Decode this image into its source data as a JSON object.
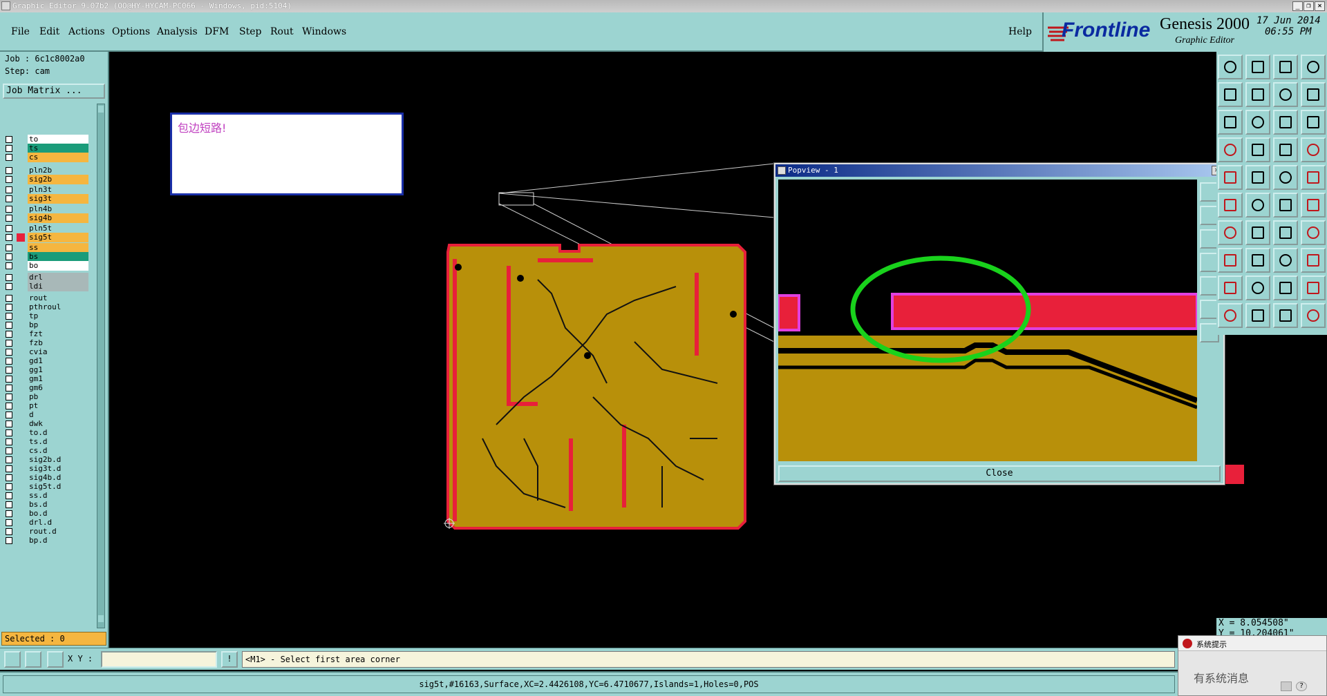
{
  "window": {
    "title": "Graphic Editor 9.07b2 (OO@HY-HYCAM-PC066 - Windows, pid:5104)",
    "controls": [
      "_",
      "❐",
      "✕"
    ]
  },
  "menu": [
    "File",
    "Edit",
    "Actions",
    "Options",
    "Analysis",
    "DFM",
    "Step",
    "Rout",
    "Windows"
  ],
  "help": "Help",
  "brand": {
    "logo": "Frontline",
    "product": "Genesis 2000",
    "subtitle": "Graphic Editor",
    "date": "17 Jun 2014",
    "time": "06:55 PM"
  },
  "job": {
    "job_line": "Job : 6c1c8002a0",
    "step_line": "Step: cam",
    "matrix_button": "Job Matrix ..."
  },
  "layers": [
    {
      "name": "to",
      "color": "#ffffff"
    },
    {
      "name": "ts",
      "color": "#1a9c7a"
    },
    {
      "name": "cs",
      "color": "#f5b640"
    },
    {
      "name": "pln2b",
      "color": "#9cd4d1"
    },
    {
      "name": "sig2b",
      "color": "#f5b640"
    },
    {
      "name": "pln3t",
      "color": "#9cd4d1"
    },
    {
      "name": "sig3t",
      "color": "#f5b640"
    },
    {
      "name": "pln4b",
      "color": "#9cd4d1"
    },
    {
      "name": "sig4b",
      "color": "#f5b640"
    },
    {
      "name": "pln5t",
      "color": "#9cd4d1"
    },
    {
      "name": "sig5t",
      "color": "#f5b640",
      "selected": true
    },
    {
      "name": "ss",
      "color": "#f5b640"
    },
    {
      "name": "bs",
      "color": "#1a9c7a"
    },
    {
      "name": "bo",
      "color": "#ffffff"
    },
    {
      "name": "drl",
      "color": "#a8b8b8"
    },
    {
      "name": "ldi",
      "color": "#a8b8b8"
    },
    {
      "name": "rout",
      "color": "#9cd4d1"
    },
    {
      "name": "pthroul",
      "color": "#9cd4d1"
    },
    {
      "name": "tp",
      "color": "#9cd4d1"
    },
    {
      "name": "bp",
      "color": "#9cd4d1"
    },
    {
      "name": "fzt",
      "color": "#9cd4d1"
    },
    {
      "name": "fzb",
      "color": "#9cd4d1"
    },
    {
      "name": "cvia",
      "color": "#9cd4d1"
    },
    {
      "name": "gd1",
      "color": "#9cd4d1"
    },
    {
      "name": "gg1",
      "color": "#9cd4d1"
    },
    {
      "name": "gm1",
      "color": "#9cd4d1"
    },
    {
      "name": "gm6",
      "color": "#9cd4d1"
    },
    {
      "name": "pb",
      "color": "#9cd4d1"
    },
    {
      "name": "pt",
      "color": "#9cd4d1"
    },
    {
      "name": "d",
      "color": "#9cd4d1"
    },
    {
      "name": "dwk",
      "color": "#9cd4d1"
    },
    {
      "name": "to.d",
      "color": "#9cd4d1"
    },
    {
      "name": "ts.d",
      "color": "#9cd4d1"
    },
    {
      "name": "cs.d",
      "color": "#9cd4d1"
    },
    {
      "name": "sig2b.d",
      "color": "#9cd4d1"
    },
    {
      "name": "sig3t.d",
      "color": "#9cd4d1"
    },
    {
      "name": "sig4b.d",
      "color": "#9cd4d1"
    },
    {
      "name": "sig5t.d",
      "color": "#9cd4d1"
    },
    {
      "name": "ss.d",
      "color": "#9cd4d1"
    },
    {
      "name": "bs.d",
      "color": "#9cd4d1"
    },
    {
      "name": "bo.d",
      "color": "#9cd4d1"
    },
    {
      "name": "drl.d",
      "color": "#9cd4d1"
    },
    {
      "name": "rout.d",
      "color": "#9cd4d1"
    },
    {
      "name": "bp.d",
      "color": "#9cd4d1"
    }
  ],
  "selected": "Selected : 0",
  "note": "包边短路!",
  "popview": {
    "title": "Popview - 1",
    "close_button": "Close"
  },
  "coords": {
    "x_line": "X = 8.054508\"",
    "y_line": "Y = 10.204061\""
  },
  "cmd": {
    "xy_label": "X Y :",
    "xy_value": "",
    "prompt": "<M1> - Select first area corner"
  },
  "status": "sig5t,#16163,Surface,XC=2.4426108,YC=6.4710677,Islands=1,Holes=0,POS",
  "notice": {
    "title": "系统提示",
    "message": "有系统消息"
  },
  "colors": {
    "panel": "#9cd4d1",
    "board_copper": "#b8900a",
    "board_outline": "#e8203a",
    "highlight_ring": "#19d21c"
  }
}
